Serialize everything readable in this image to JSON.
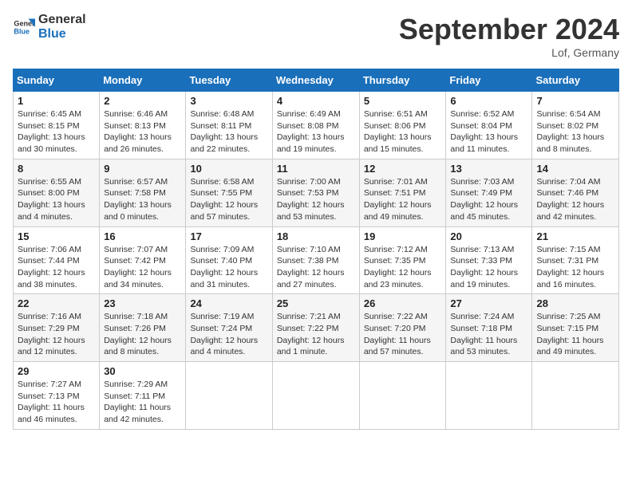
{
  "header": {
    "logo_general": "General",
    "logo_blue": "Blue",
    "month_title": "September 2024",
    "location": "Lof, Germany"
  },
  "weekdays": [
    "Sunday",
    "Monday",
    "Tuesday",
    "Wednesday",
    "Thursday",
    "Friday",
    "Saturday"
  ],
  "weeks": [
    [
      {
        "day": "1",
        "info": "Sunrise: 6:45 AM\nSunset: 8:15 PM\nDaylight: 13 hours\nand 30 minutes."
      },
      {
        "day": "2",
        "info": "Sunrise: 6:46 AM\nSunset: 8:13 PM\nDaylight: 13 hours\nand 26 minutes."
      },
      {
        "day": "3",
        "info": "Sunrise: 6:48 AM\nSunset: 8:11 PM\nDaylight: 13 hours\nand 22 minutes."
      },
      {
        "day": "4",
        "info": "Sunrise: 6:49 AM\nSunset: 8:08 PM\nDaylight: 13 hours\nand 19 minutes."
      },
      {
        "day": "5",
        "info": "Sunrise: 6:51 AM\nSunset: 8:06 PM\nDaylight: 13 hours\nand 15 minutes."
      },
      {
        "day": "6",
        "info": "Sunrise: 6:52 AM\nSunset: 8:04 PM\nDaylight: 13 hours\nand 11 minutes."
      },
      {
        "day": "7",
        "info": "Sunrise: 6:54 AM\nSunset: 8:02 PM\nDaylight: 13 hours\nand 8 minutes."
      }
    ],
    [
      {
        "day": "8",
        "info": "Sunrise: 6:55 AM\nSunset: 8:00 PM\nDaylight: 13 hours\nand 4 minutes."
      },
      {
        "day": "9",
        "info": "Sunrise: 6:57 AM\nSunset: 7:58 PM\nDaylight: 13 hours\nand 0 minutes."
      },
      {
        "day": "10",
        "info": "Sunrise: 6:58 AM\nSunset: 7:55 PM\nDaylight: 12 hours\nand 57 minutes."
      },
      {
        "day": "11",
        "info": "Sunrise: 7:00 AM\nSunset: 7:53 PM\nDaylight: 12 hours\nand 53 minutes."
      },
      {
        "day": "12",
        "info": "Sunrise: 7:01 AM\nSunset: 7:51 PM\nDaylight: 12 hours\nand 49 minutes."
      },
      {
        "day": "13",
        "info": "Sunrise: 7:03 AM\nSunset: 7:49 PM\nDaylight: 12 hours\nand 45 minutes."
      },
      {
        "day": "14",
        "info": "Sunrise: 7:04 AM\nSunset: 7:46 PM\nDaylight: 12 hours\nand 42 minutes."
      }
    ],
    [
      {
        "day": "15",
        "info": "Sunrise: 7:06 AM\nSunset: 7:44 PM\nDaylight: 12 hours\nand 38 minutes."
      },
      {
        "day": "16",
        "info": "Sunrise: 7:07 AM\nSunset: 7:42 PM\nDaylight: 12 hours\nand 34 minutes."
      },
      {
        "day": "17",
        "info": "Sunrise: 7:09 AM\nSunset: 7:40 PM\nDaylight: 12 hours\nand 31 minutes."
      },
      {
        "day": "18",
        "info": "Sunrise: 7:10 AM\nSunset: 7:38 PM\nDaylight: 12 hours\nand 27 minutes."
      },
      {
        "day": "19",
        "info": "Sunrise: 7:12 AM\nSunset: 7:35 PM\nDaylight: 12 hours\nand 23 minutes."
      },
      {
        "day": "20",
        "info": "Sunrise: 7:13 AM\nSunset: 7:33 PM\nDaylight: 12 hours\nand 19 minutes."
      },
      {
        "day": "21",
        "info": "Sunrise: 7:15 AM\nSunset: 7:31 PM\nDaylight: 12 hours\nand 16 minutes."
      }
    ],
    [
      {
        "day": "22",
        "info": "Sunrise: 7:16 AM\nSunset: 7:29 PM\nDaylight: 12 hours\nand 12 minutes."
      },
      {
        "day": "23",
        "info": "Sunrise: 7:18 AM\nSunset: 7:26 PM\nDaylight: 12 hours\nand 8 minutes."
      },
      {
        "day": "24",
        "info": "Sunrise: 7:19 AM\nSunset: 7:24 PM\nDaylight: 12 hours\nand 4 minutes."
      },
      {
        "day": "25",
        "info": "Sunrise: 7:21 AM\nSunset: 7:22 PM\nDaylight: 12 hours\nand 1 minute."
      },
      {
        "day": "26",
        "info": "Sunrise: 7:22 AM\nSunset: 7:20 PM\nDaylight: 11 hours\nand 57 minutes."
      },
      {
        "day": "27",
        "info": "Sunrise: 7:24 AM\nSunset: 7:18 PM\nDaylight: 11 hours\nand 53 minutes."
      },
      {
        "day": "28",
        "info": "Sunrise: 7:25 AM\nSunset: 7:15 PM\nDaylight: 11 hours\nand 49 minutes."
      }
    ],
    [
      {
        "day": "29",
        "info": "Sunrise: 7:27 AM\nSunset: 7:13 PM\nDaylight: 11 hours\nand 46 minutes."
      },
      {
        "day": "30",
        "info": "Sunrise: 7:29 AM\nSunset: 7:11 PM\nDaylight: 11 hours\nand 42 minutes."
      },
      {
        "day": "",
        "info": ""
      },
      {
        "day": "",
        "info": ""
      },
      {
        "day": "",
        "info": ""
      },
      {
        "day": "",
        "info": ""
      },
      {
        "day": "",
        "info": ""
      }
    ]
  ]
}
